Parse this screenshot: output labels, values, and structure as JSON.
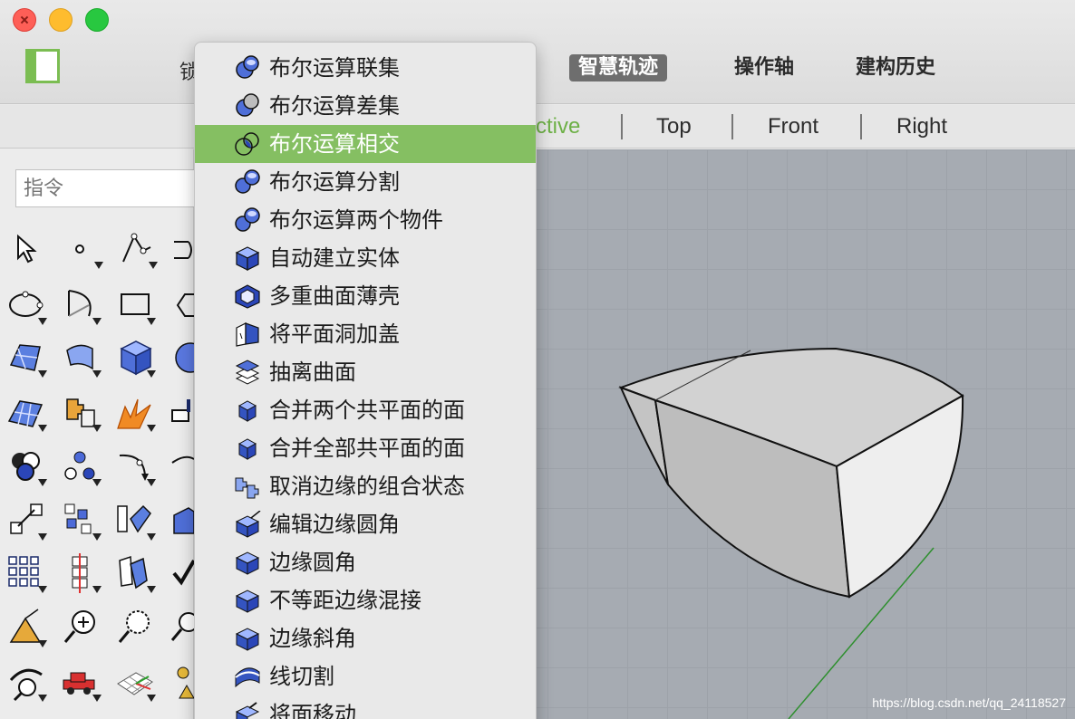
{
  "toolbar": {
    "cut_text": "锁",
    "tabs": [
      {
        "label": "智慧轨迹",
        "active": true
      },
      {
        "label": "操作轴",
        "active": false
      },
      {
        "label": "建构历史",
        "active": false
      }
    ]
  },
  "viewport_tabs": {
    "perspective_partial": "ctive",
    "top": "Top",
    "front": "Front",
    "right": "Right"
  },
  "command": {
    "placeholder": "指令"
  },
  "menu": {
    "items": [
      {
        "label": "布尔运算联集",
        "icon": "boolean-union-icon"
      },
      {
        "label": "布尔运算差集",
        "icon": "boolean-difference-icon"
      },
      {
        "label": "布尔运算相交",
        "icon": "boolean-intersection-icon",
        "highlighted": true
      },
      {
        "label": "布尔运算分割",
        "icon": "boolean-split-icon"
      },
      {
        "label": "布尔运算两个物件",
        "icon": "boolean-two-objects-icon"
      },
      {
        "label": "自动建立实体",
        "icon": "create-solid-icon"
      },
      {
        "label": "多重曲面薄壳",
        "icon": "shell-icon"
      },
      {
        "label": "将平面洞加盖",
        "icon": "cap-icon"
      },
      {
        "label": "抽离曲面",
        "icon": "extract-surface-icon"
      },
      {
        "label": "合并两个共平面的面",
        "icon": "merge-face-icon"
      },
      {
        "label": "合并全部共平面的面",
        "icon": "merge-all-faces-icon"
      },
      {
        "label": "取消边缘的组合状态",
        "icon": "unjoin-edge-icon"
      },
      {
        "label": "编辑边缘圆角",
        "icon": "edit-fillet-edge-icon"
      },
      {
        "label": "边缘圆角",
        "icon": "fillet-edge-icon"
      },
      {
        "label": "不等距边缘混接",
        "icon": "blend-edge-icon"
      },
      {
        "label": "边缘斜角",
        "icon": "chamfer-edge-icon"
      },
      {
        "label": "线切割",
        "icon": "wire-cut-icon"
      },
      {
        "label": "将面移动",
        "icon": "move-face-icon"
      }
    ]
  },
  "watermark": "https://blog.csdn.net/qq_24118527",
  "colors": {
    "accent": "#85bf62",
    "viewport": "#a6abb2",
    "active_tab": "#6e6e6e"
  }
}
